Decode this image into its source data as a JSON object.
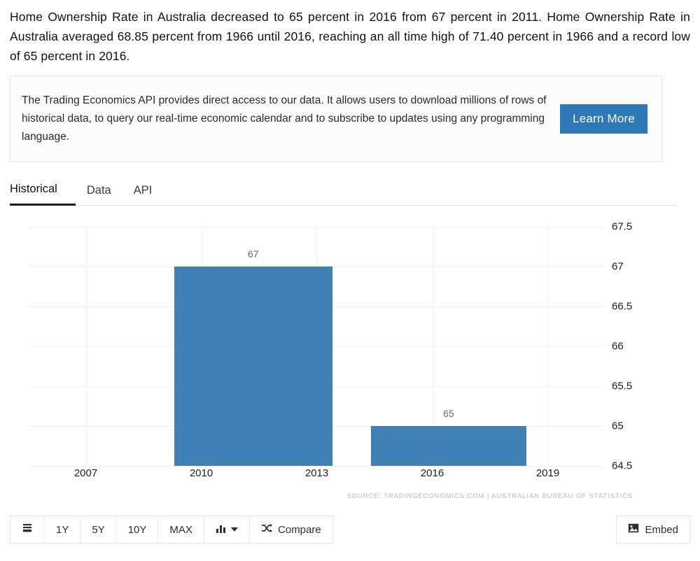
{
  "intro": {
    "text": "Home Ownership Rate in Australia decreased to 65 percent in 2016 from 67 percent in 2011. Home Ownership Rate in Australia averaged 68.85 percent from 1966 until 2016, reaching an all time high of 71.40 percent in 1966 and a record low of 65 percent in 2016."
  },
  "api_panel": {
    "text": "The Trading Economics API provides direct access to our data. It allows users to download millions of rows of historical data, to query our real-time economic calendar and to subscribe to updates using any programming language.",
    "button_label": "Learn More",
    "button_color": "#2e7ab8"
  },
  "tabs": [
    {
      "label": "Historical",
      "active": true
    },
    {
      "label": "Data",
      "active": false
    },
    {
      "label": "API",
      "active": false
    }
  ],
  "toolbar": {
    "menu_icon": "list-icon",
    "ranges": [
      "1Y",
      "5Y",
      "10Y",
      "MAX"
    ],
    "chart_type_icon": "bar-chart-icon",
    "compare_icon": "shuffle-icon",
    "compare_label": "Compare",
    "embed_icon": "image-icon",
    "embed_label": "Embed"
  },
  "chart_data": {
    "type": "bar",
    "title": "",
    "xlabel": "",
    "ylabel": "",
    "categories": [
      "2011",
      "2016"
    ],
    "values": [
      67,
      65
    ],
    "data_labels": [
      "67",
      "65"
    ],
    "bar_color": "#4180b4",
    "ylim": [
      64.5,
      67.5
    ],
    "yticks": [
      67.5,
      67,
      66.5,
      66,
      65.5,
      65,
      64.5
    ],
    "ytick_labels": [
      "67.5",
      "67",
      "66.5",
      "66",
      "65.5",
      "65",
      "64.5"
    ],
    "xticks": [
      2007,
      2010,
      2013,
      2016,
      2019
    ],
    "xtick_labels": [
      "2007",
      "2010",
      "2013",
      "2016",
      "2019"
    ],
    "xlim": [
      2005.5,
      2020.5
    ],
    "grid": true,
    "legend": false,
    "source": "SOURCE: TRADINGECONOMICS.COM | AUSTRALIAN BUREAU OF STATISTICS"
  }
}
